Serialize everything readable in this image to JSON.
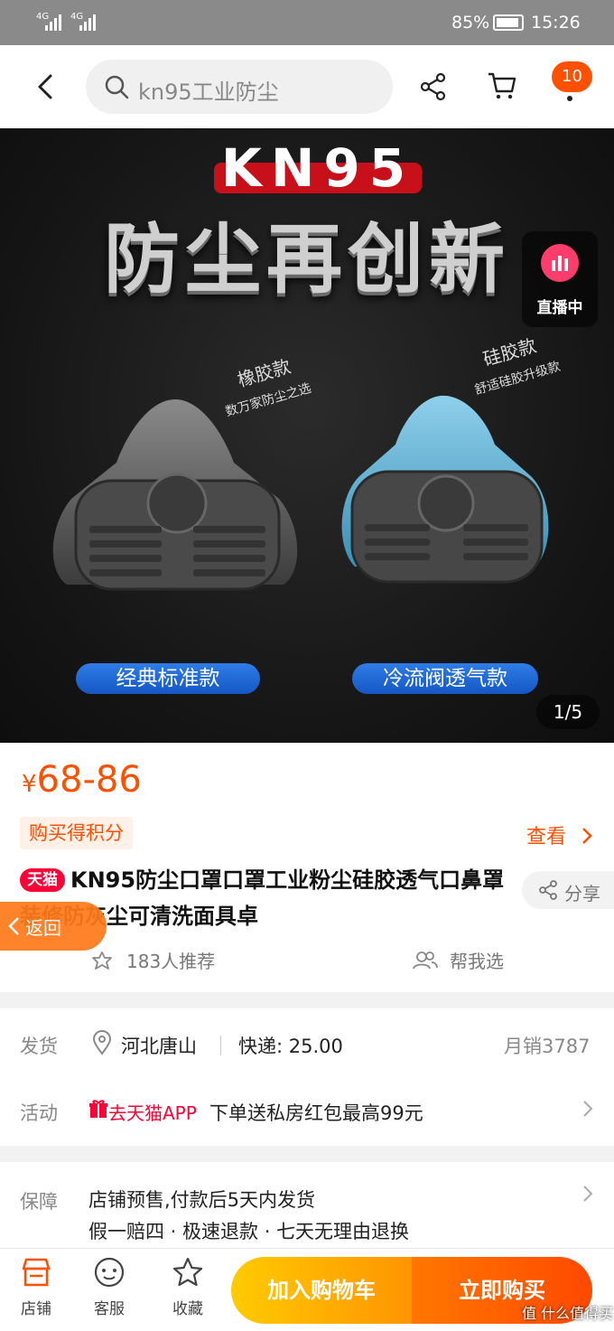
{
  "status_bar": {
    "signal1": "4G",
    "signal2": "4G",
    "battery": "85%",
    "time": "15:26"
  },
  "nav": {
    "search_text": "kn95工业防尘",
    "cart_badge": "10"
  },
  "gallery": {
    "badge_text": "KN95",
    "headline": "防尘再创新",
    "live_label": "直播中",
    "left_tag": "橡胶款",
    "left_sub": "数万家防尘之选",
    "right_tag": "硅胶款",
    "right_sub": "舒适硅胶升级款",
    "left_pill": "经典标准款",
    "right_pill": "冷流阀透气款",
    "counter": "1/5"
  },
  "product": {
    "currency": "¥",
    "price": "68-86",
    "points_tag": "购买得积分",
    "check_label": "查看",
    "tmall_badge": "天猫",
    "title": "KN95防尘口罩口罩工业粉尘硅胶透气口鼻罩装修防灰尘可清洗面具卓",
    "share_label": "分享",
    "back_label": "返回",
    "recommend": "183人推荐",
    "help_choose": "帮我选"
  },
  "shipping": {
    "label": "发货",
    "location": "河北唐山",
    "express": "快递: 25.00",
    "monthly_sales": "月销3787",
    "activity_label": "活动",
    "activity_tag": "去天猫APP",
    "activity_text": "下单送私房红包最高99元"
  },
  "guarantee": {
    "label": "保障",
    "line1": "店铺预售,付款后5天内发货",
    "line2": "假一赔四 · 极速退款 · 七天无理由退换"
  },
  "bottom_bar": {
    "shop": "店铺",
    "service": "客服",
    "favorite": "收藏",
    "add_cart": "加入购物车",
    "buy_now": "立即购买"
  },
  "watermark": "值 什么值得买",
  "colors": {
    "accent": "#ff5000",
    "tmall": "#ff0036"
  }
}
